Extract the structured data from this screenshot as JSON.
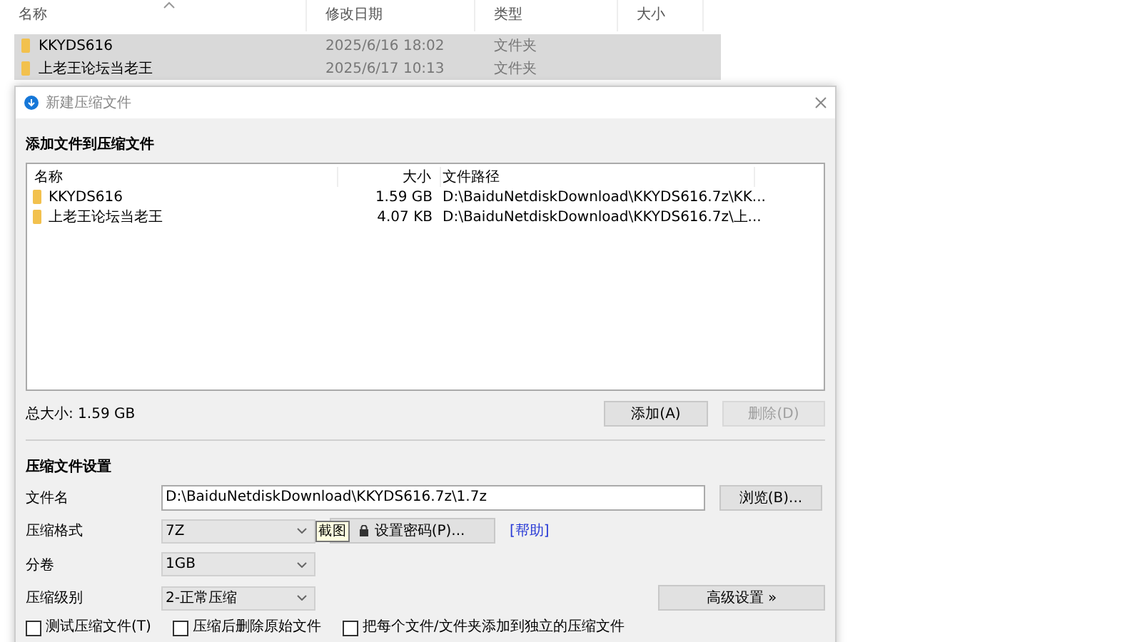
{
  "explorer": {
    "columns": [
      "名称",
      "修改日期",
      "类型",
      "大小"
    ],
    "rows": [
      {
        "name": "KKYDS616",
        "date": "2025/6/16 18:02",
        "type": "文件夹",
        "selected": true
      },
      {
        "name": "上老王论坛当老王",
        "date": "2025/6/17 10:13",
        "type": "文件夹",
        "selected": true
      }
    ]
  },
  "dialog": {
    "title": "新建压缩文件",
    "section_add": "添加文件到压缩文件",
    "list": {
      "columns": [
        "名称",
        "大小",
        "文件路径"
      ],
      "rows": [
        {
          "name": "KKYDS616",
          "size": "1.59 GB",
          "path": "D:\\BaiduNetdiskDownload\\KKYDS616.7z\\KK..."
        },
        {
          "name": "上老王论坛当老王",
          "size": "4.07 KB",
          "path": "D:\\BaiduNetdiskDownload\\KKYDS616.7z\\上..."
        }
      ]
    },
    "total": "总大小: 1.59 GB",
    "add_button": {
      "label": "添加(A)",
      "disabled": false
    },
    "delete_button": {
      "label": "删除(D)",
      "disabled": true
    },
    "section_settings": "压缩文件设置",
    "filename": {
      "label": "文件名",
      "value": "D:\\BaiduNetdiskDownload\\KKYDS616.7z\\1.7z"
    },
    "browse_button": "浏览(B)...",
    "format": {
      "label": "压缩格式",
      "value": "7Z"
    },
    "tooltip": "截图",
    "password_button": "设置密码(P)...",
    "help_link": "[帮助]",
    "volume": {
      "label": "分卷",
      "value": "1GB"
    },
    "level": {
      "label": "压缩级别",
      "value": "2-正常压缩"
    },
    "advanced_button": "高级设置 »",
    "options": [
      {
        "label": "测试压缩文件(T)",
        "checked": false
      },
      {
        "label": "压缩后删除原始文件",
        "checked": false
      },
      {
        "label": "把每个文件/文件夹添加到独立的压缩文件",
        "checked": false
      }
    ]
  }
}
